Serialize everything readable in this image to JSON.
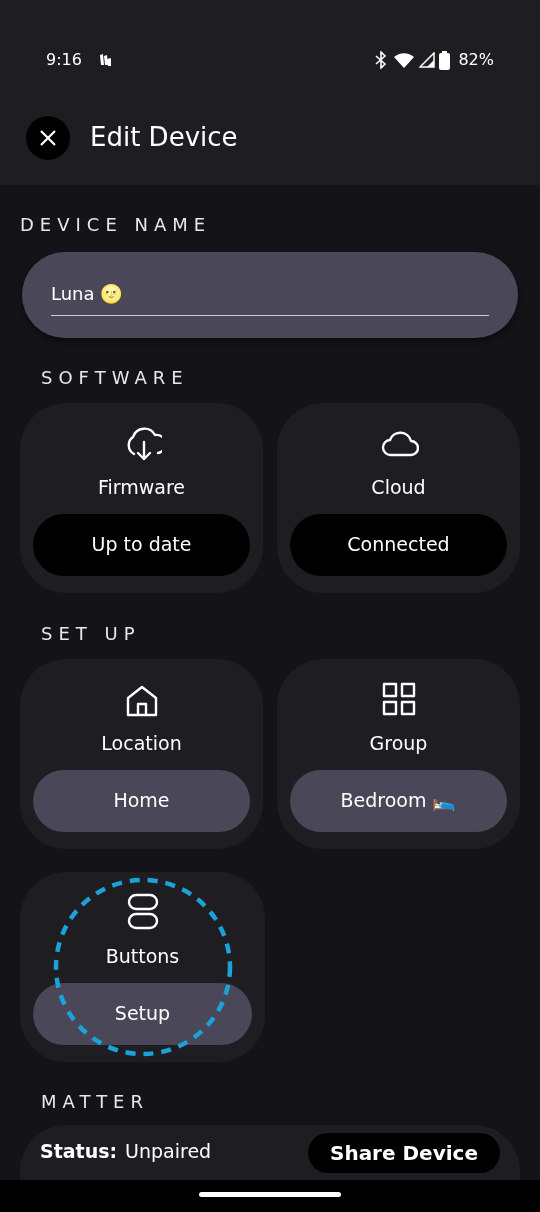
{
  "status_bar": {
    "time": "9:16",
    "battery": "82%"
  },
  "header": {
    "title": "Edit Device"
  },
  "device_name": {
    "label": "DEVICE NAME",
    "value": "Luna 🌝"
  },
  "sections": [
    {
      "title": "SOFTWARE",
      "cards": [
        {
          "label": "Firmware",
          "action": "Up to date",
          "kind": "status",
          "highlighted": false
        },
        {
          "label": "Cloud",
          "action": "Connected",
          "kind": "status",
          "highlighted": false
        }
      ]
    },
    {
      "title": "SET UP",
      "cards": [
        {
          "label": "Location",
          "action": "Home",
          "kind": "action",
          "highlighted": false
        },
        {
          "label": "Group",
          "action": "Bedroom 🛌",
          "kind": "action",
          "highlighted": false
        },
        {
          "label": "Buttons",
          "action": "Setup",
          "kind": "action",
          "highlighted": true
        }
      ]
    }
  ],
  "matter": {
    "title": "MATTER",
    "status_label": "Status:",
    "status_value": "Unpaired",
    "share_button": "Share Device"
  }
}
